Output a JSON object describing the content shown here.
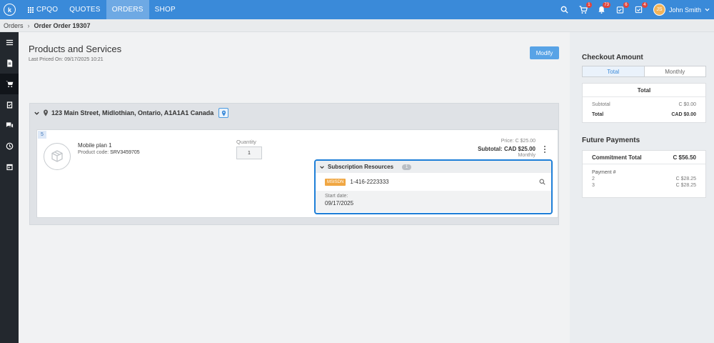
{
  "topbar": {
    "logo_letter": "k",
    "app_name": "CPQO",
    "nav": [
      {
        "label": "QUOTES",
        "active": false
      },
      {
        "label": "ORDERS",
        "active": true
      },
      {
        "label": "SHOP",
        "active": false
      }
    ],
    "badges": {
      "cart": "1",
      "bell": "73",
      "tasks": "6",
      "approvals": "4"
    },
    "user_initials": "JS",
    "user_name": "John Smith",
    "accent_color": "#3a8ad9"
  },
  "breadcrumb": {
    "root": "Orders",
    "current": "Order Order 19307"
  },
  "sidebar": {
    "items": [
      "menu-icon",
      "document-icon",
      "cart-icon",
      "clipboard-icon",
      "chat-icon",
      "history-icon",
      "calendar-icon"
    ],
    "active_index": 2
  },
  "main": {
    "title": "Products and Services",
    "last_priced_label": "Last Priced On:",
    "last_priced_value": "09/17/2025 10:21",
    "modify_label": "Modify",
    "location": "123 Main Street, Midlothian, Ontario, A1A1A1 Canada",
    "item": {
      "seq": "5",
      "name": "Mobile plan 1",
      "code_label": "Product code:",
      "code_value": "SRV3459705",
      "quantity_label": "Quantity",
      "quantity_value": "1",
      "price_label": "Price:",
      "price_value": "C $25.00",
      "subtotal_label": "Subtotal:",
      "subtotal_value": "CAD $25.00",
      "frequency": "Monthly"
    },
    "subscription": {
      "title": "Subscription Resources",
      "count": "1",
      "tag": "MSISDN",
      "value": "1-416-2223333",
      "start_label": "Start date:",
      "start_value": "09/17/2025"
    }
  },
  "right": {
    "checkout_title": "Checkout Amount",
    "toggle": [
      "Total",
      "Monthly"
    ],
    "total_box": {
      "head": "Total",
      "rows": [
        {
          "label": "Subtotal",
          "value": "C $0.00"
        },
        {
          "label": "Total",
          "value": "CAD $0.00"
        }
      ]
    },
    "future_title": "Future Payments",
    "future_box": {
      "head_label": "Commitment Total",
      "head_value": "C $56.50",
      "payment_label": "Payment #",
      "rows": [
        {
          "label": "2",
          "value": "C $28.25"
        },
        {
          "label": "3",
          "value": "C $28.25"
        }
      ]
    }
  }
}
